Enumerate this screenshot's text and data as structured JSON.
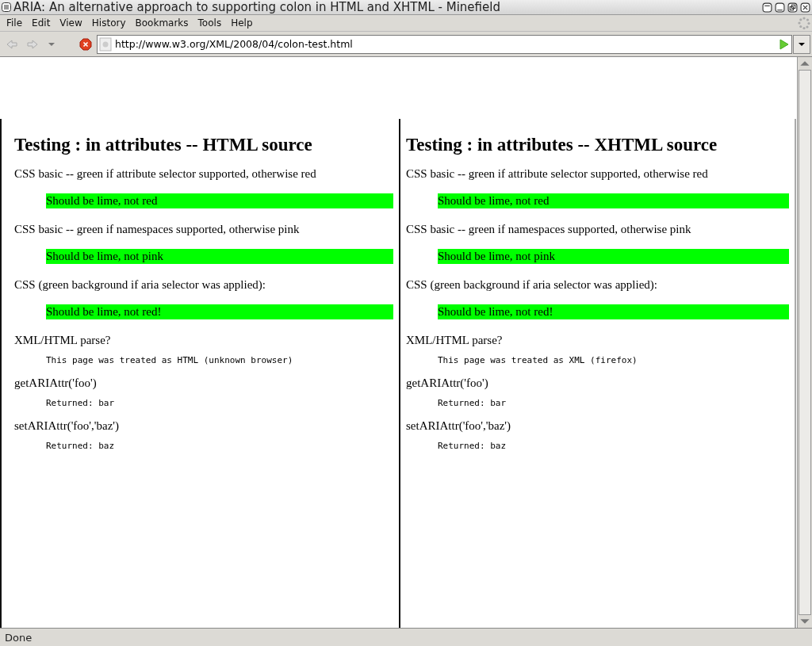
{
  "window": {
    "title": "ARIA: An alternative approach to supporting colon in HTML and XHTML - Minefield"
  },
  "menu": [
    "File",
    "Edit",
    "View",
    "History",
    "Bookmarks",
    "Tools",
    "Help"
  ],
  "address": {
    "value": "http://www.w3.org/XML/2008/04/colon-test.html"
  },
  "panes": [
    {
      "heading": "Testing : in attributes -- HTML source",
      "sections": [
        {
          "label": "CSS basic -- green if attribute selector supported, otherwise red",
          "kind": "box",
          "result": "Should be lime, not red"
        },
        {
          "label": "CSS basic -- green if namespaces supported, otherwise pink",
          "kind": "box",
          "result": "Should be lime, not pink"
        },
        {
          "label": "CSS (green background if aria selector was applied):",
          "kind": "box",
          "result": "Should be lime, not red!"
        },
        {
          "label": "XML/HTML parse?",
          "kind": "mono",
          "result": "This page was treated as HTML (unknown browser)"
        },
        {
          "label": "getARIAttr('foo')",
          "kind": "mono",
          "result": "Returned: bar"
        },
        {
          "label": "setARIAttr('foo','baz')",
          "kind": "mono",
          "result": "Returned: baz"
        }
      ]
    },
    {
      "heading": "Testing : in attributes -- XHTML source",
      "sections": [
        {
          "label": "CSS basic -- green if attribute selector supported, otherwise red",
          "kind": "box",
          "result": "Should be lime, not red"
        },
        {
          "label": "CSS basic -- green if namespaces supported, otherwise pink",
          "kind": "box",
          "result": "Should be lime, not pink"
        },
        {
          "label": "CSS (green background if aria selector was applied):",
          "kind": "box",
          "result": "Should be lime, not red!"
        },
        {
          "label": "XML/HTML parse?",
          "kind": "mono",
          "result": "This page was treated as XML (firefox)"
        },
        {
          "label": "getARIAttr('foo')",
          "kind": "mono",
          "result": "Returned: bar"
        },
        {
          "label": "setARIAttr('foo','baz')",
          "kind": "mono",
          "result": "Returned: baz"
        }
      ]
    }
  ],
  "status_bar": {
    "text": "Done"
  }
}
